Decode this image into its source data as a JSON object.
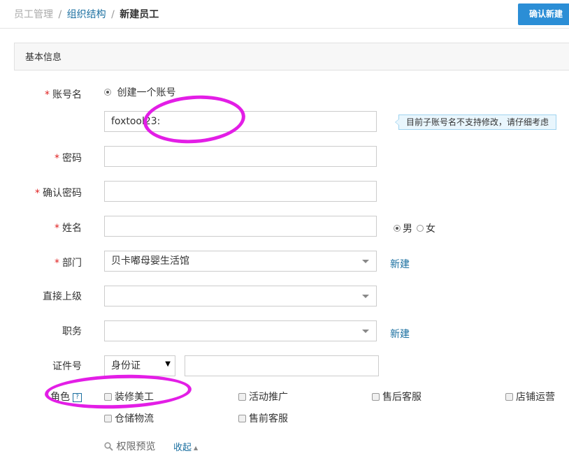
{
  "header": {
    "breadcrumb": [
      "员工管理",
      "组织结构",
      "新建员工"
    ],
    "breadcrumb_sep": "/",
    "confirm_button": "确认新建"
  },
  "section": {
    "title": "基本信息"
  },
  "form": {
    "required_mark": "*",
    "account": {
      "label": "账号名",
      "create_option": "创建一个账号",
      "value": "foxtool23:",
      "tip": "目前子账号名不支持修改，请仔细考虑"
    },
    "password": {
      "label": "密码",
      "value": ""
    },
    "confirm_password": {
      "label": "确认密码",
      "value": ""
    },
    "name": {
      "label": "姓名",
      "value": "",
      "gender_male": "男",
      "gender_female": "女",
      "gender_selected": "男"
    },
    "department": {
      "label": "部门",
      "value": "贝卡嘟母婴生活馆",
      "new_link": "新建"
    },
    "supervisor": {
      "label": "直接上级",
      "value": ""
    },
    "position": {
      "label": "职务",
      "value": "",
      "new_link": "新建"
    },
    "id_number": {
      "label": "证件号",
      "type": "身份证",
      "value": ""
    },
    "role": {
      "label": "角色",
      "help_icon": "?",
      "options": [
        "装修美工",
        "活动推广",
        "售后客服",
        "店铺运营",
        "仓储物流",
        "售前客服"
      ]
    },
    "permission_preview": "权限预览",
    "collapse_link": "收起"
  },
  "icons": {
    "search": "search-icon",
    "caret_up": "caret-up-icon",
    "help": "help-icon",
    "dropdown": "chevron-down-icon"
  },
  "colors": {
    "link": "#1a6fa0",
    "confirm_button": "#2b8ed6",
    "required": "#e02020",
    "annotation": "#e31ee6"
  }
}
